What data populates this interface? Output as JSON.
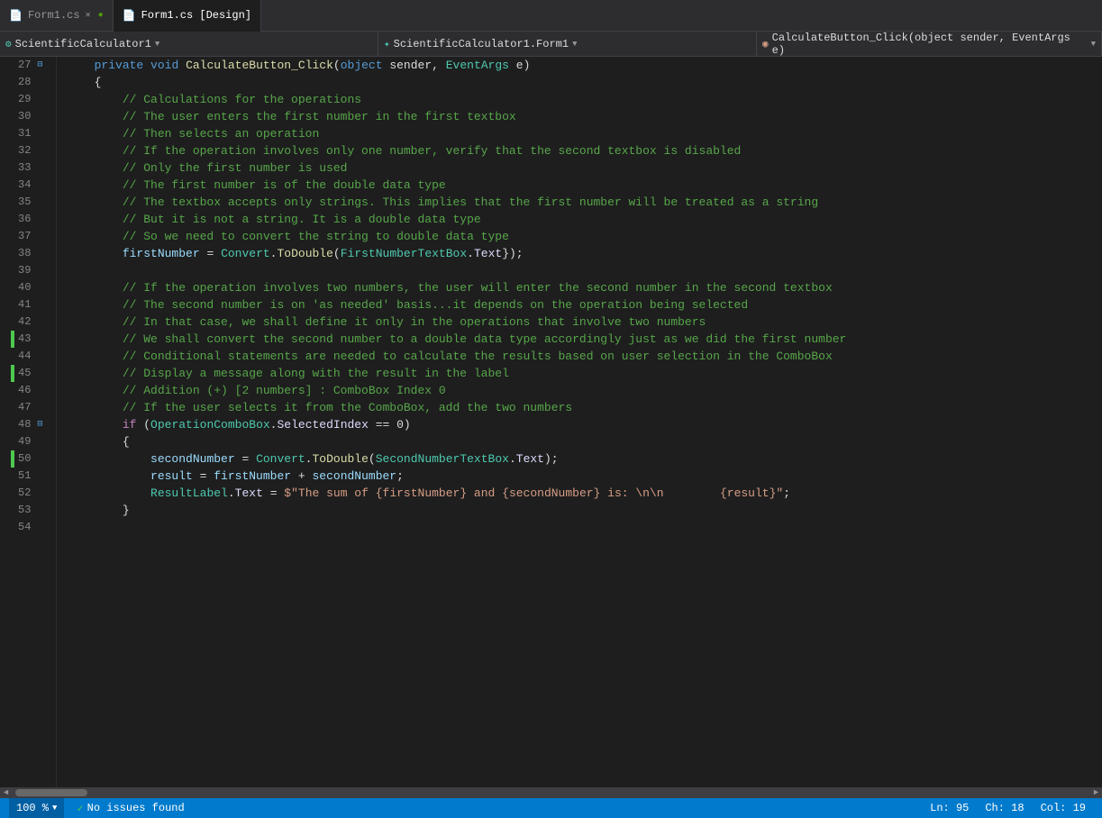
{
  "titleBar": {
    "tabs": [
      {
        "id": "form1cs",
        "label": "Form1.cs",
        "icon": "📄",
        "active": false,
        "closable": true
      },
      {
        "id": "form1design",
        "label": "Form1.cs [Design]",
        "icon": "📄",
        "active": true,
        "closable": false
      }
    ]
  },
  "toolbar": {
    "dropdowns": [
      {
        "id": "dd1",
        "icon": "⚙",
        "label": "ScientificCalculator1",
        "arrow": "▼"
      },
      {
        "id": "dd2",
        "icon": "✦",
        "label": "ScientificCalculator1.Form1",
        "arrow": "▼"
      },
      {
        "id": "dd3",
        "icon": "◉",
        "label": "CalculateButton_Click(object sender, EventArgs e)",
        "arrow": "▼"
      }
    ]
  },
  "lines": [
    {
      "num": "27",
      "collapse": "-",
      "green": false,
      "code": [
        {
          "cls": "plain",
          "t": "    "
        },
        {
          "cls": "kw",
          "t": "private"
        },
        {
          "cls": "plain",
          "t": " "
        },
        {
          "cls": "kw",
          "t": "void"
        },
        {
          "cls": "plain",
          "t": " "
        },
        {
          "cls": "method",
          "t": "CalculateButton_Click"
        },
        {
          "cls": "plain",
          "t": "("
        },
        {
          "cls": "kw",
          "t": "object"
        },
        {
          "cls": "plain",
          "t": " sender, "
        },
        {
          "cls": "type",
          "t": "EventArgs"
        },
        {
          "cls": "plain",
          "t": " e)"
        }
      ]
    },
    {
      "num": "28",
      "collapse": "",
      "green": false,
      "code": [
        {
          "cls": "plain",
          "t": "    {"
        }
      ]
    },
    {
      "num": "29",
      "collapse": "",
      "green": false,
      "code": [
        {
          "cls": "comment",
          "t": "        // Calculations for the operations"
        }
      ]
    },
    {
      "num": "30",
      "collapse": "",
      "green": false,
      "code": [
        {
          "cls": "comment",
          "t": "        // The user enters the first number in the first textbox"
        }
      ]
    },
    {
      "num": "31",
      "collapse": "",
      "green": false,
      "code": [
        {
          "cls": "comment",
          "t": "        // Then selects an operation"
        }
      ]
    },
    {
      "num": "32",
      "collapse": "",
      "green": false,
      "code": [
        {
          "cls": "comment",
          "t": "        // If the operation involves only one number, verify that the second textbox is disabled"
        }
      ]
    },
    {
      "num": "33",
      "collapse": "",
      "green": false,
      "code": [
        {
          "cls": "comment",
          "t": "        // Only the first number is used"
        }
      ]
    },
    {
      "num": "34",
      "collapse": "",
      "green": false,
      "code": [
        {
          "cls": "comment",
          "t": "        // The first number is of the double data type"
        }
      ]
    },
    {
      "num": "35",
      "collapse": "",
      "green": false,
      "code": [
        {
          "cls": "comment",
          "t": "        // The textbox accepts only strings. This implies that the first number will be treated as a string"
        }
      ]
    },
    {
      "num": "36",
      "collapse": "",
      "green": false,
      "code": [
        {
          "cls": "comment",
          "t": "        // But it is not a string. It is a double data type"
        }
      ]
    },
    {
      "num": "37",
      "collapse": "",
      "green": false,
      "code": [
        {
          "cls": "comment",
          "t": "        // So we need to convert the string to double data type"
        }
      ]
    },
    {
      "num": "38",
      "collapse": "",
      "green": false,
      "code": [
        {
          "cls": "plain",
          "t": "        "
        },
        {
          "cls": "var",
          "t": "firstNumber"
        },
        {
          "cls": "plain",
          "t": " = "
        },
        {
          "cls": "classname",
          "t": "Convert"
        },
        {
          "cls": "plain",
          "t": "."
        },
        {
          "cls": "method",
          "t": "ToDouble"
        },
        {
          "cls": "plain",
          "t": "("
        },
        {
          "cls": "classname",
          "t": "FirstNumberTextBox"
        },
        {
          "cls": "plain",
          "t": "."
        },
        {
          "cls": "prop",
          "t": "Text"
        },
        {
          "cls": "plain",
          "t": "});"
        }
      ]
    },
    {
      "num": "39",
      "collapse": "",
      "green": false,
      "code": []
    },
    {
      "num": "40",
      "collapse": "",
      "green": false,
      "code": [
        {
          "cls": "comment",
          "t": "        // If the operation involves two numbers, the user will enter the second number in the second textbox"
        }
      ]
    },
    {
      "num": "41",
      "collapse": "",
      "green": false,
      "code": [
        {
          "cls": "comment",
          "t": "        // The second number is on 'as needed' basis...it depends on the operation being selected"
        }
      ]
    },
    {
      "num": "42",
      "collapse": "",
      "green": false,
      "code": [
        {
          "cls": "comment",
          "t": "        // In that case, we shall define it only in the operations that involve two numbers"
        }
      ]
    },
    {
      "num": "43",
      "collapse": "",
      "green": true,
      "code": [
        {
          "cls": "comment",
          "t": "        // We shall convert the second number to a double data type accordingly just as we did the first number"
        }
      ]
    },
    {
      "num": "44",
      "collapse": "",
      "green": false,
      "code": [
        {
          "cls": "comment",
          "t": "        // Conditional statements are needed to calculate the results based on user selection in the ComboBox"
        }
      ]
    },
    {
      "num": "45",
      "collapse": "",
      "green": true,
      "code": [
        {
          "cls": "comment",
          "t": "        // Display a message along with the result in the label"
        }
      ]
    },
    {
      "num": "46",
      "collapse": "",
      "green": false,
      "code": [
        {
          "cls": "comment",
          "t": "        // Addition (+) [2 numbers] : ComboBox Index 0"
        }
      ]
    },
    {
      "num": "47",
      "collapse": "",
      "green": false,
      "code": [
        {
          "cls": "comment",
          "t": "        // If the user selects it from the ComboBox, add the two numbers"
        }
      ]
    },
    {
      "num": "48",
      "collapse": "-",
      "green": false,
      "code": [
        {
          "cls": "plain",
          "t": "        "
        },
        {
          "cls": "kw2",
          "t": "if"
        },
        {
          "cls": "plain",
          "t": " ("
        },
        {
          "cls": "classname",
          "t": "OperationComboBox"
        },
        {
          "cls": "plain",
          "t": "."
        },
        {
          "cls": "prop",
          "t": "SelectedIndex"
        },
        {
          "cls": "plain",
          "t": " == 0)"
        }
      ]
    },
    {
      "num": "49",
      "collapse": "",
      "green": false,
      "code": [
        {
          "cls": "plain",
          "t": "        {"
        }
      ]
    },
    {
      "num": "50",
      "collapse": "",
      "green": true,
      "code": [
        {
          "cls": "plain",
          "t": "            "
        },
        {
          "cls": "var",
          "t": "secondNumber"
        },
        {
          "cls": "plain",
          "t": " = "
        },
        {
          "cls": "classname",
          "t": "Convert"
        },
        {
          "cls": "plain",
          "t": "."
        },
        {
          "cls": "method",
          "t": "ToDouble"
        },
        {
          "cls": "plain",
          "t": "("
        },
        {
          "cls": "classname",
          "t": "SecondNumberTextBox"
        },
        {
          "cls": "plain",
          "t": "."
        },
        {
          "cls": "prop",
          "t": "Text"
        },
        {
          "cls": "plain",
          "t": ");"
        }
      ]
    },
    {
      "num": "51",
      "collapse": "",
      "green": false,
      "code": [
        {
          "cls": "plain",
          "t": "            "
        },
        {
          "cls": "var",
          "t": "result"
        },
        {
          "cls": "plain",
          "t": " = "
        },
        {
          "cls": "var",
          "t": "firstNumber"
        },
        {
          "cls": "plain",
          "t": " + "
        },
        {
          "cls": "var",
          "t": "secondNumber"
        },
        {
          "cls": "plain",
          "t": ";"
        }
      ]
    },
    {
      "num": "52",
      "collapse": "",
      "green": false,
      "code": [
        {
          "cls": "plain",
          "t": "            "
        },
        {
          "cls": "classname",
          "t": "ResultLabel"
        },
        {
          "cls": "plain",
          "t": "."
        },
        {
          "cls": "prop",
          "t": "Text"
        },
        {
          "cls": "plain",
          "t": " = "
        },
        {
          "cls": "dollar",
          "t": "$\"The sum of {firstNumber} and {secondNumber} is: \\n\\n        {result}\""
        },
        {
          "cls": "plain",
          "t": ";"
        }
      ]
    },
    {
      "num": "53",
      "collapse": "",
      "green": false,
      "code": [
        {
          "cls": "plain",
          "t": "        }"
        }
      ]
    },
    {
      "num": "54",
      "collapse": "",
      "green": false,
      "code": []
    }
  ],
  "statusBar": {
    "zoom": "100 %",
    "zoomArrow": "▼",
    "statusIcon": "✓",
    "statusText": "No issues found",
    "scrollLeft": "◄",
    "scrollRight": "►",
    "lineCol": "Ln: 95",
    "ch": "Ch: 18",
    "col": "Col: 19"
  }
}
